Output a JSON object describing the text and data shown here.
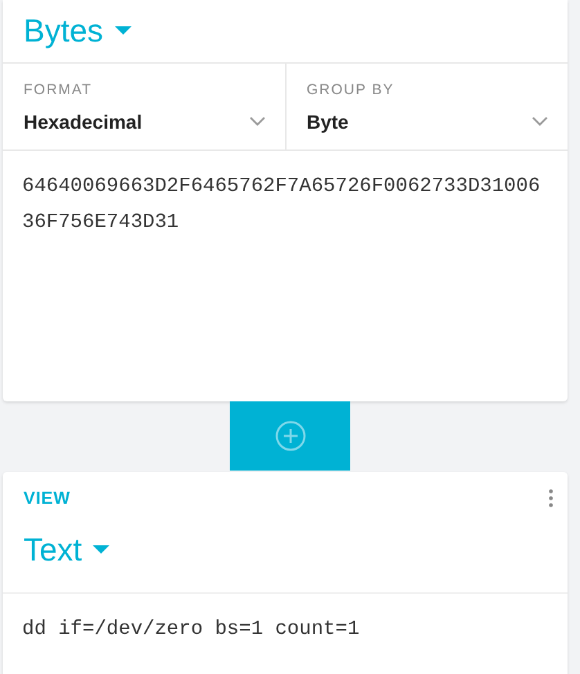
{
  "input_card": {
    "title": "Bytes",
    "fields": [
      {
        "label": "FORMAT",
        "value": "Hexadecimal"
      },
      {
        "label": "GROUP BY",
        "value": "Byte"
      }
    ],
    "content": "64640069663D2F6465762F7A65726F0062733D3100636F756E743D31"
  },
  "output_card": {
    "section_label": "VIEW",
    "title": "Text",
    "content": "dd if=/dev/zero bs=1 count=1"
  }
}
